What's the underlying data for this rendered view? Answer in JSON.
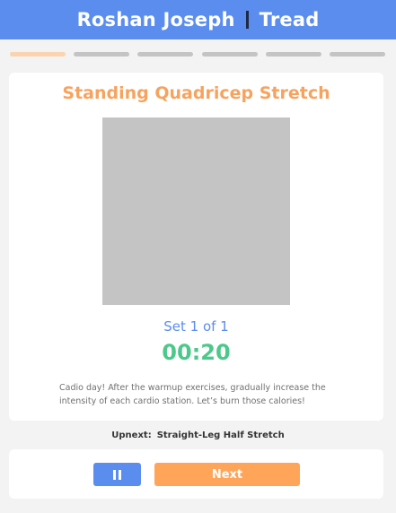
{
  "header": {
    "user_name": "Roshan Joseph",
    "app_name": "Tread"
  },
  "progress": {
    "segments_total": 6,
    "active_index": 0
  },
  "exercise": {
    "title": "Standing Quadricep Stretch",
    "set_label": "Set 1 of 1",
    "timer": "00:20",
    "description": "Cadio day! After the warmup exercises, gradually increase the intensity of each cardio station. Let’s burn those calories!"
  },
  "upnext": {
    "label": "Upnext:",
    "name": "Straight-Leg Half Stretch"
  },
  "controls": {
    "pause_icon": "pause-icon",
    "next_label": "Next"
  },
  "colors": {
    "header_bg": "#5b8def",
    "accent_orange": "#f6a35f",
    "timer_green": "#4cc98a",
    "set_blue": "#5b8def"
  }
}
